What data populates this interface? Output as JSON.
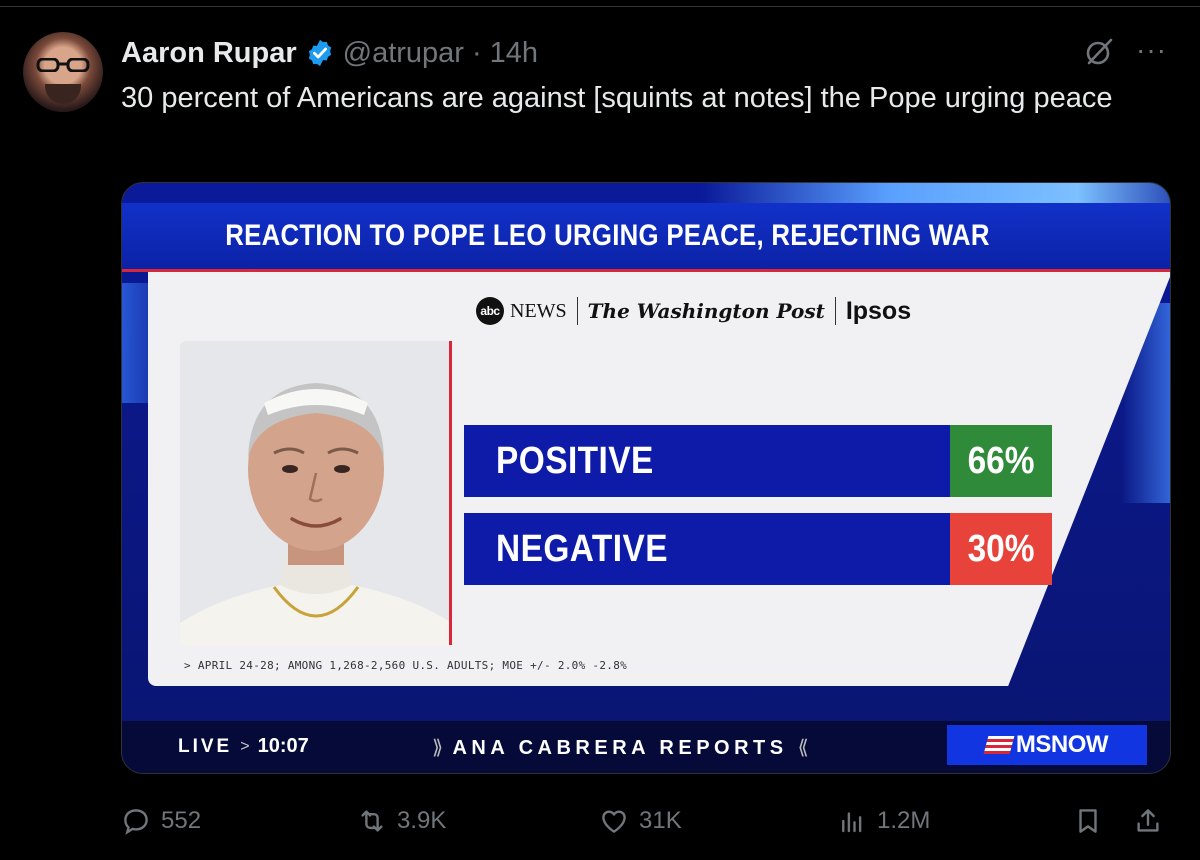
{
  "tweet": {
    "author_name": "Aaron Rupar",
    "handle": "@atrupar",
    "separator": "·",
    "time": "14h",
    "text": "30 percent of Americans are against [squints at notes] the Pope urging peace",
    "more_label": "···"
  },
  "media": {
    "banner_title": "REACTION TO POPE LEO URGING PEACE, REJECTING WAR",
    "sources": {
      "abc": "abc",
      "news": "NEWS",
      "wapo": "The Washington Post",
      "ipsos": "Ipsos"
    },
    "bars": [
      {
        "label": "POSITIVE",
        "value": "66%",
        "color": "#2f8a3a"
      },
      {
        "label": "NEGATIVE",
        "value": "30%",
        "color": "#e8433a"
      }
    ],
    "footnote": "> APRIL 24-28; AMONG 1,268-2,560 U.S. ADULTS; MOE +/- 2.0% -2.8%",
    "live_label": "LIVE",
    "live_chevron": ">",
    "live_time": "10:07",
    "show_open": "⟫",
    "show_name": "ANA CABRERA REPORTS",
    "show_close": "⟪",
    "network": "MSNOW"
  },
  "actions": {
    "replies": "552",
    "reposts": "3.9K",
    "likes": "31K",
    "views": "1.2M"
  },
  "colors": {
    "accent": "#1d9bf0",
    "muted": "#71767b",
    "panel_blue": "#0d1ba8"
  }
}
